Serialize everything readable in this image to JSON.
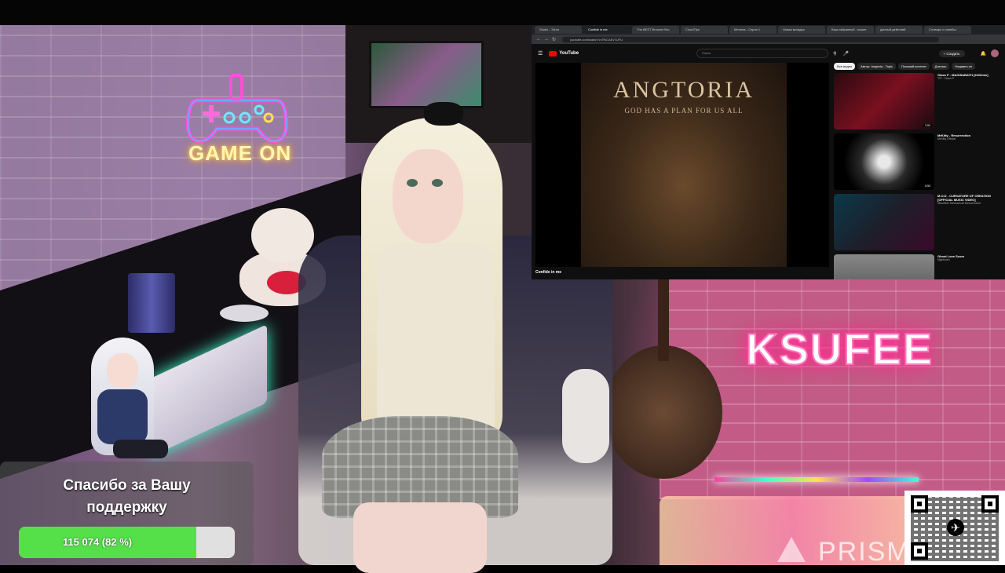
{
  "scene": {
    "neon_left": "GAME ON",
    "neon_right": "KSUFEE",
    "watermark": "PRISM"
  },
  "youtube": {
    "tabs": [
      "Studio - Tuber",
      "Confide in me",
      "The BEST Browser Bro",
      "CloudTips",
      "Метаем - Серия 1",
      "Новая вкладка",
      "Ваш избранный - может",
      "данный.действий",
      "Словарь и новейш"
    ],
    "url": "youtube.com/watch?v=PACAEvTUFU",
    "logo": "YouTube",
    "search_placeholder": "Поиск",
    "create_label": "+ Создать",
    "album_title": "ANGTORIA",
    "album_subtitle": "GOD HAS A PLAN FOR US ALL",
    "video_title": "Confide in me",
    "chips": [
      "Все видео",
      "Автор: Angtoria - Topic",
      "Похожий контент",
      "Для вас",
      "Недавно оп"
    ],
    "suggestions": [
      {
        "title": "Glass P - MAGISABATH [2020mix]",
        "channel": "TIP - Glass P",
        "stats": "",
        "duration": "3:59"
      },
      {
        "title": "MrKitty - Resurrection",
        "channel": "MrKitty Official",
        "stats": "",
        "duration": "5:50"
      },
      {
        "title": "M.O.D - CURVATURE OF CREATION [OFFICIAL MUSIC VIDEO]",
        "channel": "Mandible Mechanical Resurrection",
        "stats": "",
        "duration": ""
      },
      {
        "title": "Ghost Love Score",
        "channel": "Nightwish",
        "stats": "",
        "duration": ""
      }
    ]
  },
  "donation": {
    "message_line1": "Спасибо за Вашу",
    "message_line2": "поддержку",
    "progress_text": "115 074 (82 %)",
    "progress_fraction": 0.82
  },
  "colors": {
    "progress_fill": "#55e04a",
    "youtube_red": "#ff0000",
    "neon_pink": "#ff2a88"
  }
}
